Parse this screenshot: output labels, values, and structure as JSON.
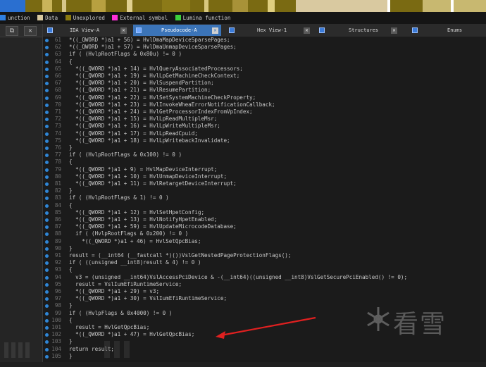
{
  "legend": {
    "items": [
      {
        "label": "unction",
        "color": "#2f7fe0"
      },
      {
        "label": "Data",
        "color": "#d9c9a0"
      },
      {
        "label": "Unexplored",
        "color": "#8a7a10"
      },
      {
        "label": "External symbol",
        "color": "#ff30d8"
      },
      {
        "label": "Lumina function",
        "color": "#3cd03c"
      }
    ]
  },
  "tabs": [
    {
      "label": "IDA View-A",
      "active": false
    },
    {
      "label": "Pseudocode-A",
      "active": true
    },
    {
      "label": "Hex View-1",
      "active": false
    },
    {
      "label": "Structures",
      "active": false
    },
    {
      "label": "Enums",
      "active": false
    }
  ],
  "code_lines": [
    {
      "n": "61",
      "t": "*((_QWORD *)a1 + 56) = HvlDmaMapDeviceSparsePages;"
    },
    {
      "n": "62",
      "t": "*((_QWORD *)a1 + 57) = HvlDmaUnmapDeviceSparsePages;"
    },
    {
      "n": "63",
      "t": "if ( (HvlpRootFlags & 0x80u) != 0 )"
    },
    {
      "n": "64",
      "t": "{"
    },
    {
      "n": "65",
      "t": "  *((_QWORD *)a1 + 14) = HvlQueryAssociatedProcessors;"
    },
    {
      "n": "66",
      "t": "  *((_QWORD *)a1 + 19) = HvlLpGetMachineCheckContext;"
    },
    {
      "n": "67",
      "t": "  *((_QWORD *)a1 + 20) = HvlSuspendPartition;"
    },
    {
      "n": "68",
      "t": "  *((_QWORD *)a1 + 21) = HvlResumePartition;"
    },
    {
      "n": "69",
      "t": "  *((_QWORD *)a1 + 22) = HvlSetSystemMachineCheckProperty;"
    },
    {
      "n": "70",
      "t": "  *((_QWORD *)a1 + 23) = HvlInvokeWheaErrorNotificationCallback;"
    },
    {
      "n": "71",
      "t": "  *((_QWORD *)a1 + 24) = HvlGetProcessorIndexFromVpIndex;"
    },
    {
      "n": "72",
      "t": "  *((_QWORD *)a1 + 15) = HvlLpReadMultipleMsr;"
    },
    {
      "n": "73",
      "t": "  *((_QWORD *)a1 + 16) = HvlLpWriteMultipleMsr;"
    },
    {
      "n": "74",
      "t": "  *((_QWORD *)a1 + 17) = HvlLpReadCpuid;"
    },
    {
      "n": "75",
      "t": "  *((_QWORD *)a1 + 18) = HvlLpWritebackInvalidate;"
    },
    {
      "n": "76",
      "t": "}"
    },
    {
      "n": "77",
      "t": "if ( (HvlpRootFlags & 0x100) != 0 )"
    },
    {
      "n": "78",
      "t": "{"
    },
    {
      "n": "79",
      "t": "  *((_QWORD *)a1 + 9) = HvlMapDeviceInterrupt;"
    },
    {
      "n": "80",
      "t": "  *((_QWORD *)a1 + 10) = HvlUnmapDeviceInterrupt;"
    },
    {
      "n": "81",
      "t": "  *((_QWORD *)a1 + 11) = HvlRetargetDeviceInterrupt;"
    },
    {
      "n": "82",
      "t": "}"
    },
    {
      "n": "83",
      "t": "if ( (HvlpRootFlags & 1) != 0 )"
    },
    {
      "n": "84",
      "t": "{"
    },
    {
      "n": "85",
      "t": "  *((_QWORD *)a1 + 12) = HvlSetHpetConfig;"
    },
    {
      "n": "86",
      "t": "  *((_QWORD *)a1 + 13) = HvlNotifyHpetEnabled;"
    },
    {
      "n": "87",
      "t": "  *((_QWORD *)a1 + 59) = HvlUpdateMicrocodeDatabase;"
    },
    {
      "n": "88",
      "t": "  if ( (HvlpRootFlags & 0x200) != 0 )"
    },
    {
      "n": "89",
      "t": "    *((_QWORD *)a1 + 46) = HvlSetQpcBias;"
    },
    {
      "n": "90",
      "t": "}"
    },
    {
      "n": "91",
      "t": "result = (__int64 (__fastcall *)())VslGetNestedPageProtectionFlags();"
    },
    {
      "n": "92",
      "t": "if ( ((unsigned __int8)result & 4) != 0 )"
    },
    {
      "n": "93",
      "t": "{"
    },
    {
      "n": "94",
      "t": "  v3 = (unsigned __int64)VslAccessPciDevice & -(__int64)((unsigned __int8)VslGetSecurePciEnabled() != 0);"
    },
    {
      "n": "95",
      "t": "  result = VslIumEfiRuntimeService;"
    },
    {
      "n": "96",
      "t": "  *((_QWORD *)a1 + 29) = v3;"
    },
    {
      "n": "97",
      "t": "  *((_QWORD *)a1 + 30) = VslIumEfiRuntimeService;"
    },
    {
      "n": "98",
      "t": "}"
    },
    {
      "n": "99",
      "t": "if ( (HvlpFlags & 0x4000) != 0 )"
    },
    {
      "n": "100",
      "t": "{"
    },
    {
      "n": "101",
      "t": "  result = HvlGetQpcBias;"
    },
    {
      "n": "102",
      "t": "  *((_QWORD *)a1 + 47) = HvlGetQpcBias;"
    },
    {
      "n": "103",
      "t": "}"
    },
    {
      "n": "104",
      "t": "return result;"
    },
    {
      "n": "105",
      "t": "}"
    }
  ],
  "watermark": {
    "text": "看雪"
  },
  "colors": {
    "annotation_arrow": "#e02020",
    "gutter_dot": "#2f86d6",
    "active_tab": "#3b74b8"
  }
}
